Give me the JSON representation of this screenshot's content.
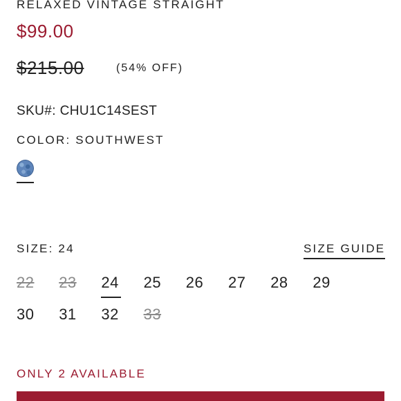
{
  "product": {
    "title": "RELAXED VINTAGE STRAIGHT",
    "sale_price": "$99.00",
    "original_price": "$215.00",
    "discount": "(54% OFF)",
    "sku": "SKU#: CHU1C14SEST"
  },
  "color": {
    "label": "COLOR: SOUTHWEST",
    "swatch_icon": "denim-swatch-icon",
    "swatch_color": "#5f86bb"
  },
  "size": {
    "label": "SIZE: 24",
    "guide_link": "SIZE GUIDE",
    "selected": "24",
    "options": [
      {
        "value": "22",
        "available": false
      },
      {
        "value": "23",
        "available": false
      },
      {
        "value": "24",
        "available": true
      },
      {
        "value": "25",
        "available": true
      },
      {
        "value": "26",
        "available": true
      },
      {
        "value": "27",
        "available": true
      },
      {
        "value": "28",
        "available": true
      },
      {
        "value": "29",
        "available": true
      },
      {
        "value": "30",
        "available": true
      },
      {
        "value": "31",
        "available": true
      },
      {
        "value": "32",
        "available": true
      },
      {
        "value": "33",
        "available": false
      }
    ]
  },
  "stock": {
    "availability": "ONLY 2 AVAILABLE"
  },
  "colors": {
    "accent": "#9b1b30",
    "text": "#222222",
    "muted": "#8a8a8a"
  }
}
